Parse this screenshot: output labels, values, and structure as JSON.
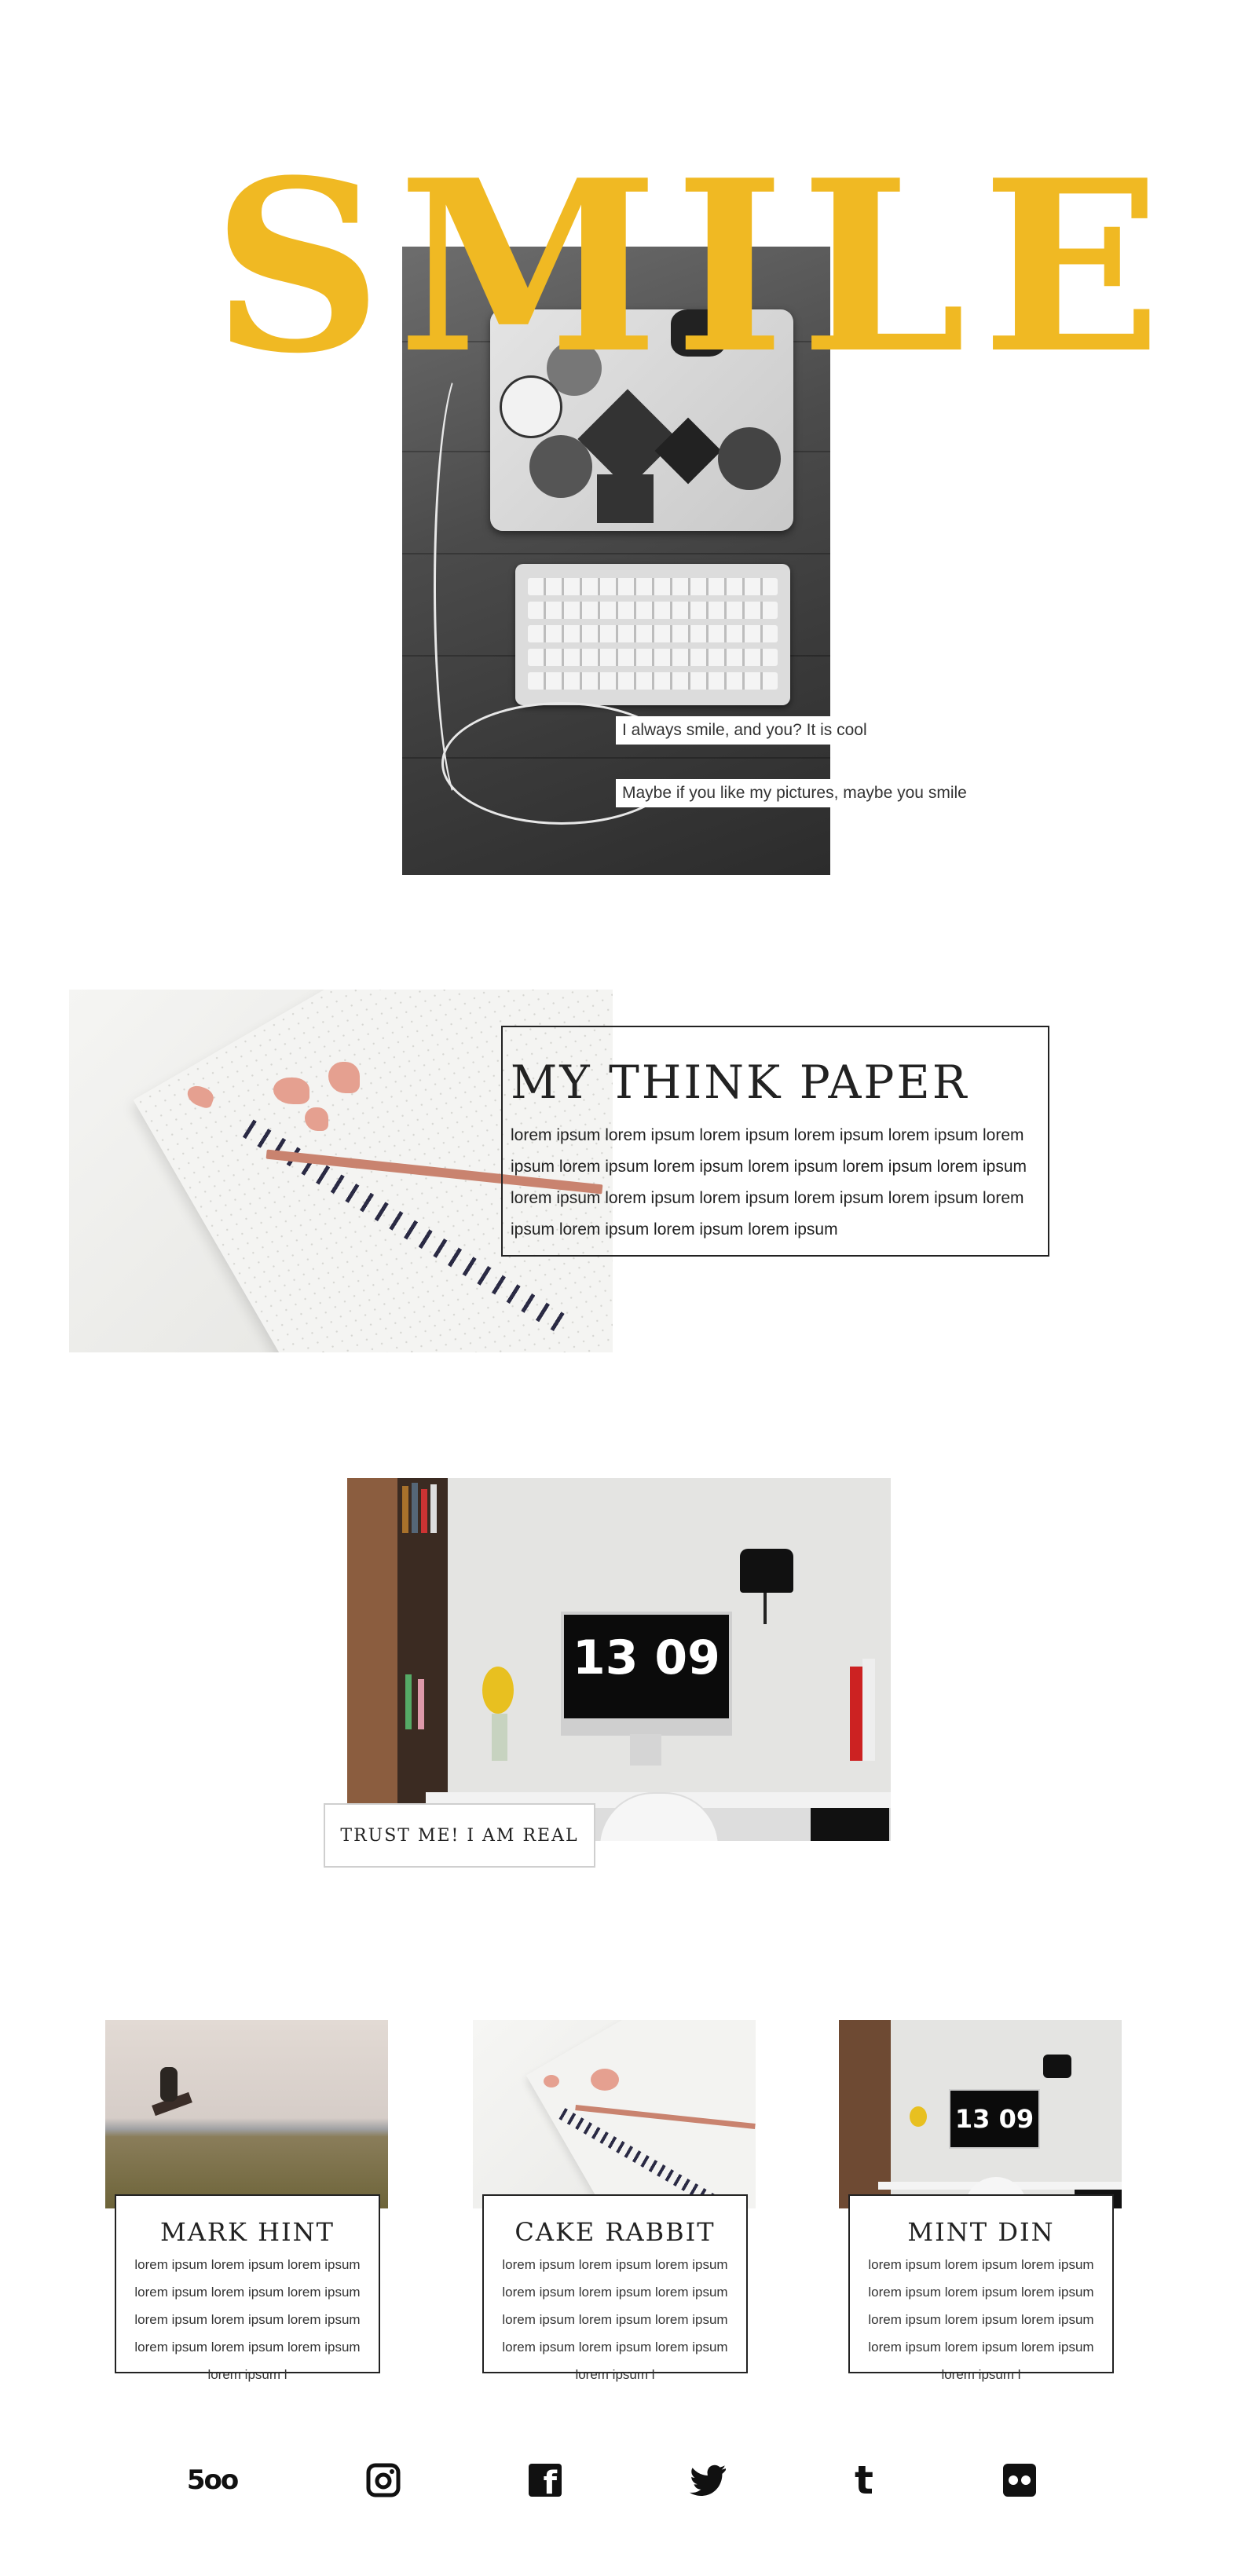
{
  "hero": {
    "title": "SMILE",
    "caption_1": "I always smile, and you? It is cool",
    "caption_2": "Maybe if you like my pictures, maybe you smile",
    "accent_color": "#f0b923"
  },
  "think": {
    "title": "MY THINK PAPER",
    "body": "lorem ipsum lorem ipsum lorem ipsum lorem ipsum lorem ipsum lorem ipsum lorem ipsum lorem ipsum lorem ipsum lorem ipsum lorem ipsum lorem ipsum lorem ipsum lorem ipsum lorem ipsum lorem ipsum lorem ipsum lorem ipsum lorem ipsum lorem ipsum"
  },
  "desk": {
    "clock": "13 09",
    "label": "TRUST ME! I AM REAL"
  },
  "cards": [
    {
      "title": "MARK HINT",
      "body": "lorem ipsum lorem ipsum lorem ipsum lorem ipsum lorem ipsum lorem ipsum lorem ipsum lorem ipsum lorem ipsum lorem ipsum lorem ipsum lorem ipsum lorem ipsum l",
      "image_clock": ""
    },
    {
      "title": "CAKE RABBIT",
      "body": "lorem ipsum lorem ipsum lorem ipsum lorem ipsum lorem ipsum lorem ipsum lorem ipsum lorem ipsum lorem ipsum lorem ipsum lorem ipsum lorem ipsum lorem ipsum l",
      "image_clock": ""
    },
    {
      "title": "MINT DIN",
      "body": "lorem ipsum lorem ipsum lorem ipsum lorem ipsum lorem ipsum lorem ipsum lorem ipsum lorem ipsum lorem ipsum lorem ipsum lorem ipsum lorem ipsum lorem ipsum l",
      "image_clock": "13 09"
    }
  ],
  "social": [
    {
      "icon": "500px-icon",
      "glyph": "5oo"
    },
    {
      "icon": "instagram-icon",
      "glyph": ""
    },
    {
      "icon": "facebook-icon",
      "glyph": "f"
    },
    {
      "icon": "twitter-icon",
      "glyph": ""
    },
    {
      "icon": "tumblr-icon",
      "glyph": "t"
    },
    {
      "icon": "flickr-icon",
      "glyph": ""
    }
  ]
}
